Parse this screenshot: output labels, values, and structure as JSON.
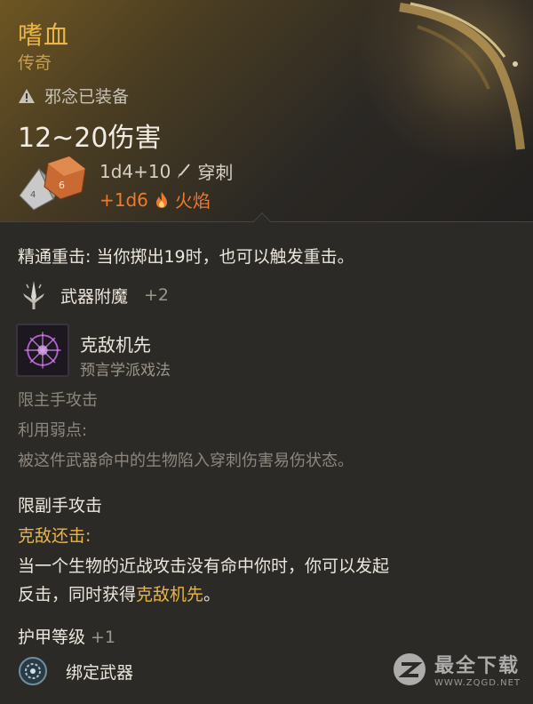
{
  "item": {
    "name": "嗜血",
    "rarity": "传奇",
    "warning_text": "邪念已装备",
    "damage_range": "12~20伤害",
    "damage_line1": {
      "dice": "1d4+10",
      "type": "穿刺"
    },
    "damage_line2": {
      "dice": "+1d6",
      "type": "火焰"
    }
  },
  "details": {
    "crit_text": "精通重击: 当你掷出19时，也可以触发重击。",
    "enchant_label": "武器附魔",
    "enchant_value": "+2",
    "spell_name": "克敌机先",
    "spell_school": "预言学派戏法",
    "mainhand_only": "限主手攻击",
    "exploit_label": "利用弱点:",
    "exploit_desc": "被这件武器命中的生物陷入穿刺伤害易伤状态。",
    "offhand_only": "限副手攻击",
    "riposte_label": "克敌还击:",
    "riposte_line1": "当一个生物的近战攻击没有命中你时，你可以发起",
    "riposte_line2_a": "反击，同时获得",
    "riposte_line2_b": "克敌机先",
    "riposte_line2_c": "。",
    "ac_label": "护甲等级",
    "ac_value": "+1",
    "bind_label": "绑定武器"
  },
  "watermark": {
    "main": "最全下载",
    "sub": "WWW.ZQGD.NET"
  },
  "colors": {
    "title": "#e9b448",
    "fire": "#f07a2a",
    "dim": "#8c867c"
  }
}
